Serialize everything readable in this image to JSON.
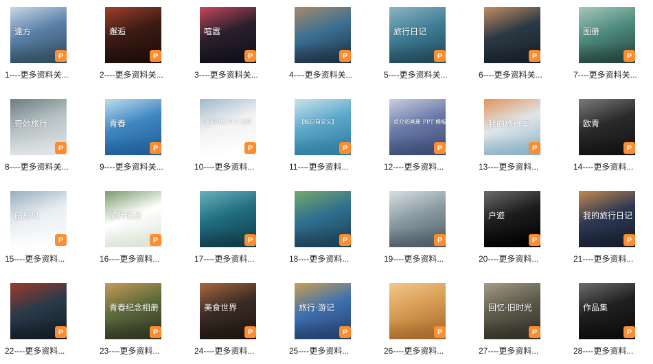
{
  "badge_letter": "P",
  "badge_color": "#ff8c2e",
  "files": [
    {
      "label": "1----更多资料关...",
      "caption": "遠方",
      "colors": [
        "#5a7fa6",
        "#c7d7e6",
        "#2f4b5c"
      ]
    },
    {
      "label": "2----更多资料关...",
      "caption": "邂逅",
      "colors": [
        "#3a1b14",
        "#a2402a",
        "#1c0c08"
      ]
    },
    {
      "label": "3----更多资料关...",
      "caption": "喧嚣",
      "colors": [
        "#2b1f2d",
        "#c7485c",
        "#0f0f1a"
      ]
    },
    {
      "label": "4----更多资料关...",
      "caption": "",
      "colors": [
        "#3b6f93",
        "#a68a6a",
        "#1d2f42"
      ]
    },
    {
      "label": "5----更多资料关...",
      "caption": "旅行日记",
      "colors": [
        "#3f7e96",
        "#8cb5c2",
        "#214556"
      ]
    },
    {
      "label": "6----更多资料关...",
      "caption": "",
      "colors": [
        "#2a3945",
        "#c78c5f",
        "#161e26"
      ]
    },
    {
      "label": "7----更多资料关...",
      "caption": "图册",
      "colors": [
        "#4e8b7d",
        "#a5c7bc",
        "#23403a"
      ]
    },
    {
      "label": "8----更多资料关...",
      "caption": "奇妙旅行",
      "colors": [
        "#b8c2c4",
        "#6c7c80",
        "#e2e6e7"
      ]
    },
    {
      "label": "9----更多资料关...",
      "caption": "青春",
      "colors": [
        "#3e86c2",
        "#bfdcef",
        "#1e5c93"
      ]
    },
    {
      "label": "10----更多资料...",
      "caption": "清新风格 PPT 模板",
      "colors": [
        "#f2f2f2",
        "#9fb8c9",
        "#ffffff"
      ]
    },
    {
      "label": "11----更多资料...",
      "caption": "【私日自定义】",
      "colors": [
        "#5aa7c9",
        "#cbe3ec",
        "#2e7aa0"
      ]
    },
    {
      "label": "12----更多资料...",
      "caption": "点介绍画册 PPT 模板",
      "colors": [
        "#6a7aa8",
        "#c9cde0",
        "#3b4a70"
      ]
    },
    {
      "label": "13----更多资料...",
      "caption": "我的旅行季",
      "colors": [
        "#dfe6e9",
        "#e3935d",
        "#8ab1c4"
      ]
    },
    {
      "label": "14----更多资料...",
      "caption": "欧青",
      "colors": [
        "#2a2a2a",
        "#7b7b7b",
        "#111111"
      ]
    },
    {
      "label": "15----更多资料...",
      "caption": "画册风",
      "colors": [
        "#e8eef2",
        "#98aebd",
        "#ffffff"
      ]
    },
    {
      "label": "16----更多资料...",
      "caption": "旅行画册",
      "colors": [
        "#ffffff",
        "#7a9a6d",
        "#d9e3d4"
      ]
    },
    {
      "label": "17----更多资料...",
      "caption": "",
      "colors": [
        "#1f6d7e",
        "#6ab0bd",
        "#0f3a46"
      ]
    },
    {
      "label": "18----更多资料...",
      "caption": "",
      "colors": [
        "#2f6f8f",
        "#76a86b",
        "#1b3e52"
      ]
    },
    {
      "label": "19----更多资料...",
      "caption": "",
      "colors": [
        "#8a9aa2",
        "#d8dfe2",
        "#4b5a61"
      ]
    },
    {
      "label": "20----更多资料...",
      "caption": "户遊",
      "colors": [
        "#1c1c1c",
        "#6b6b6b",
        "#000000"
      ]
    },
    {
      "label": "21----更多资料...",
      "caption": "我的旅行日记",
      "colors": [
        "#2d3954",
        "#c4884d",
        "#151c2c"
      ]
    },
    {
      "label": "22----更多资料...",
      "caption": "",
      "colors": [
        "#2a3a4a",
        "#9c3a2a",
        "#121a22"
      ]
    },
    {
      "label": "23----更多资料...",
      "caption": "青春纪念相册",
      "colors": [
        "#5d6a3c",
        "#c79a57",
        "#2c3320"
      ]
    },
    {
      "label": "24----更多资料...",
      "caption": "美食世界",
      "colors": [
        "#3a2b24",
        "#a8683f",
        "#1c1410"
      ]
    },
    {
      "label": "25----更多资料...",
      "caption": "旅行·游记",
      "colors": [
        "#3f70b0",
        "#c9a050",
        "#233e6a"
      ]
    },
    {
      "label": "26----更多资料...",
      "caption": "",
      "colors": [
        "#d79b52",
        "#f0c98a",
        "#a2672a"
      ]
    },
    {
      "label": "27----更多资料...",
      "caption": "回忆·旧时光",
      "colors": [
        "#5e5b4c",
        "#a29c86",
        "#2f2d24"
      ]
    },
    {
      "label": "28----更多资料...",
      "caption": "作品集",
      "colors": [
        "#1f1f1f",
        "#6d6d6d",
        "#0b0b0b"
      ]
    }
  ]
}
